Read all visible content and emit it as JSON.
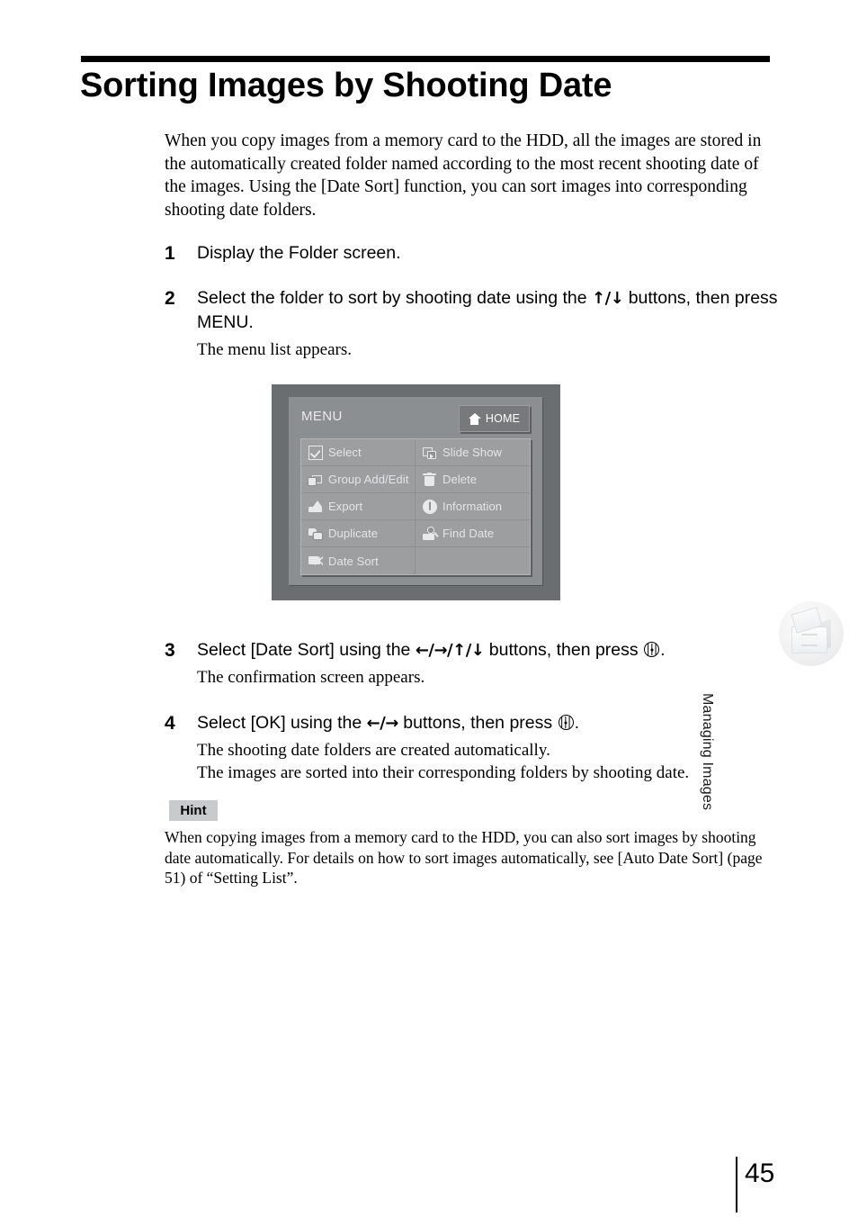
{
  "document": {
    "title": "Sorting Images by Shooting Date",
    "intro": "When you copy images from a memory card to the HDD, all the images are stored in the automatically created folder named according to the most recent shooting date of the images. Using the [Date Sort] function, you can sort images into corresponding shooting date folders.",
    "page_number": "45",
    "side_tab_label": "Managing Images"
  },
  "steps": [
    {
      "number": "1",
      "head_pre": "Display the Folder screen.",
      "head_post": "",
      "arrows": "",
      "sub": ""
    },
    {
      "number": "2",
      "head_pre": "Select the folder to sort by shooting date using the ",
      "arrows": "↑/↓",
      "head_post": " buttons, then press MENU.",
      "sub": "The menu list appears."
    },
    {
      "number": "3",
      "head_pre": "Select [Date Sort] using the ",
      "arrows": "←/→/↑/↓",
      "head_post": " buttons, then press ",
      "head_tail": ".",
      "sub": "The confirmation screen appears."
    },
    {
      "number": "4",
      "head_pre": "Select [OK] using the ",
      "arrows": "←/→",
      "head_post": " buttons, then press ",
      "head_tail": ".",
      "sub": "The shooting date folders are created automatically.",
      "sub2": "The images are sorted into their corresponding folders by shooting date."
    }
  ],
  "device_screen": {
    "header_label": "MENU",
    "home_button": {
      "label": "HOME",
      "icon": "home-icon"
    },
    "menu_items": [
      {
        "label": "Select",
        "icon": "checkbox-icon"
      },
      {
        "label": "Slide Show",
        "icon": "slideshow-icon"
      },
      {
        "label": "Group Add/Edit",
        "icon": "group-edit-icon"
      },
      {
        "label": "Delete",
        "icon": "trash-icon"
      },
      {
        "label": "Export",
        "icon": "export-icon"
      },
      {
        "label": "Information",
        "icon": "info-icon"
      },
      {
        "label": "Duplicate",
        "icon": "duplicate-icon"
      },
      {
        "label": "Find Date",
        "icon": "find-date-icon"
      },
      {
        "label": "Date Sort",
        "icon": "date-sort-icon"
      },
      {
        "label": "",
        "icon": ""
      }
    ],
    "colors": {
      "outer_frame": "#6b6e70",
      "inner_panel": "#8c8f91",
      "menu_grid": "#9c9ea0",
      "text": "#e4e5e6"
    }
  },
  "hint": {
    "badge": "Hint",
    "text": "When copying images from a memory card to the HDD, you can also sort images by shooting date automatically. For details on how to sort images automatically, see [Auto Date Sort] (page 51) of “Setting List”."
  }
}
